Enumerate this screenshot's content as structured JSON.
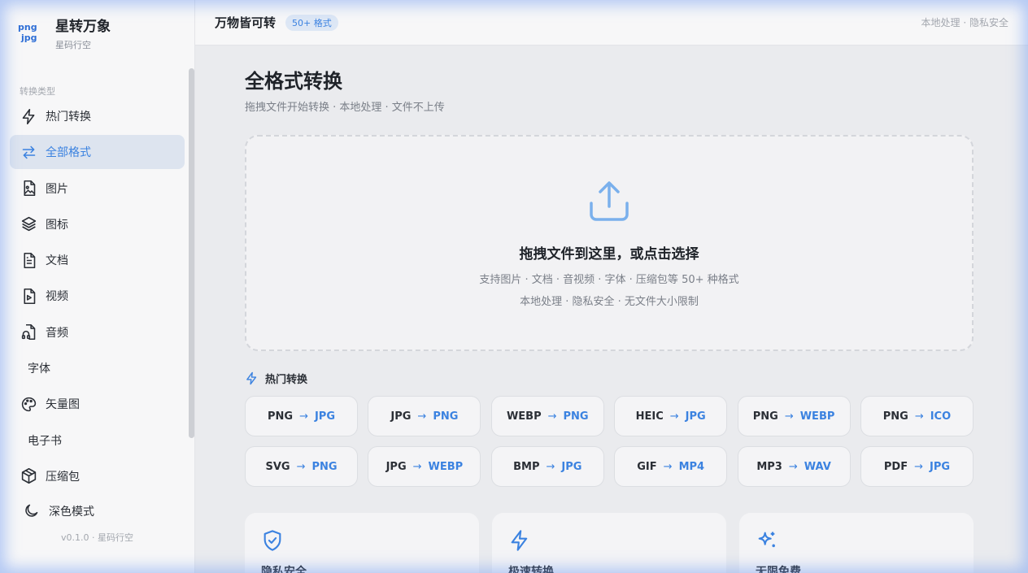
{
  "brand": {
    "logo_top": "png",
    "logo_bottom": "jpg",
    "title": "星转万象",
    "subtitle": "星码行空"
  },
  "sidebar": {
    "section_label": "转换类型",
    "items": [
      {
        "label": "热门转换",
        "icon": "lightning-icon"
      },
      {
        "label": "全部格式",
        "icon": "swap-icon",
        "active": true
      },
      {
        "label": "图片",
        "icon": "image-icon"
      },
      {
        "label": "图标",
        "icon": "layers-icon"
      },
      {
        "label": "文档",
        "icon": "document-icon"
      },
      {
        "label": "视频",
        "icon": "video-icon"
      },
      {
        "label": "音频",
        "icon": "audio-icon"
      },
      {
        "label": "字体",
        "icon": null
      },
      {
        "label": "矢量图",
        "icon": "palette-icon"
      },
      {
        "label": "电子书",
        "icon": null
      },
      {
        "label": "压缩包",
        "icon": "package-icon"
      }
    ],
    "dark_mode_label": "深色模式",
    "version": "v0.1.0 · 星码行空"
  },
  "topbar": {
    "title": "万物皆可转",
    "badge": "50+ 格式",
    "right_text": "本地处理 · 隐私安全"
  },
  "main": {
    "title": "全格式转换",
    "subtitle": "拖拽文件开始转换 · 本地处理 · 文件不上传",
    "dropzone": {
      "title": "拖拽文件到这里，或点击选择",
      "line1": "支持图片 · 文档 · 音视频 · 字体 · 压缩包等 50+ 种格式",
      "line2": "本地处理 · 隐私安全 · 无文件大小限制"
    },
    "hot_label": "热门转换",
    "conversions": [
      {
        "from": "PNG",
        "to": "JPG"
      },
      {
        "from": "JPG",
        "to": "PNG"
      },
      {
        "from": "WEBP",
        "to": "PNG"
      },
      {
        "from": "HEIC",
        "to": "JPG"
      },
      {
        "from": "PNG",
        "to": "WEBP"
      },
      {
        "from": "PNG",
        "to": "ICO"
      },
      {
        "from": "SVG",
        "to": "PNG"
      },
      {
        "from": "JPG",
        "to": "WEBP"
      },
      {
        "from": "BMP",
        "to": "JPG"
      },
      {
        "from": "GIF",
        "to": "MP4"
      },
      {
        "from": "MP3",
        "to": "WAV"
      },
      {
        "from": "PDF",
        "to": "JPG"
      }
    ],
    "arrow": "→",
    "features": [
      {
        "title": "隐私安全",
        "icon": "shield-check-icon"
      },
      {
        "title": "极速转换",
        "icon": "lightning-icon"
      },
      {
        "title": "无限免费",
        "icon": "sparkles-icon"
      }
    ]
  },
  "colors": {
    "accent": "#3b82e0",
    "active_bg": "#dde4ef",
    "background": "#eaebee"
  }
}
